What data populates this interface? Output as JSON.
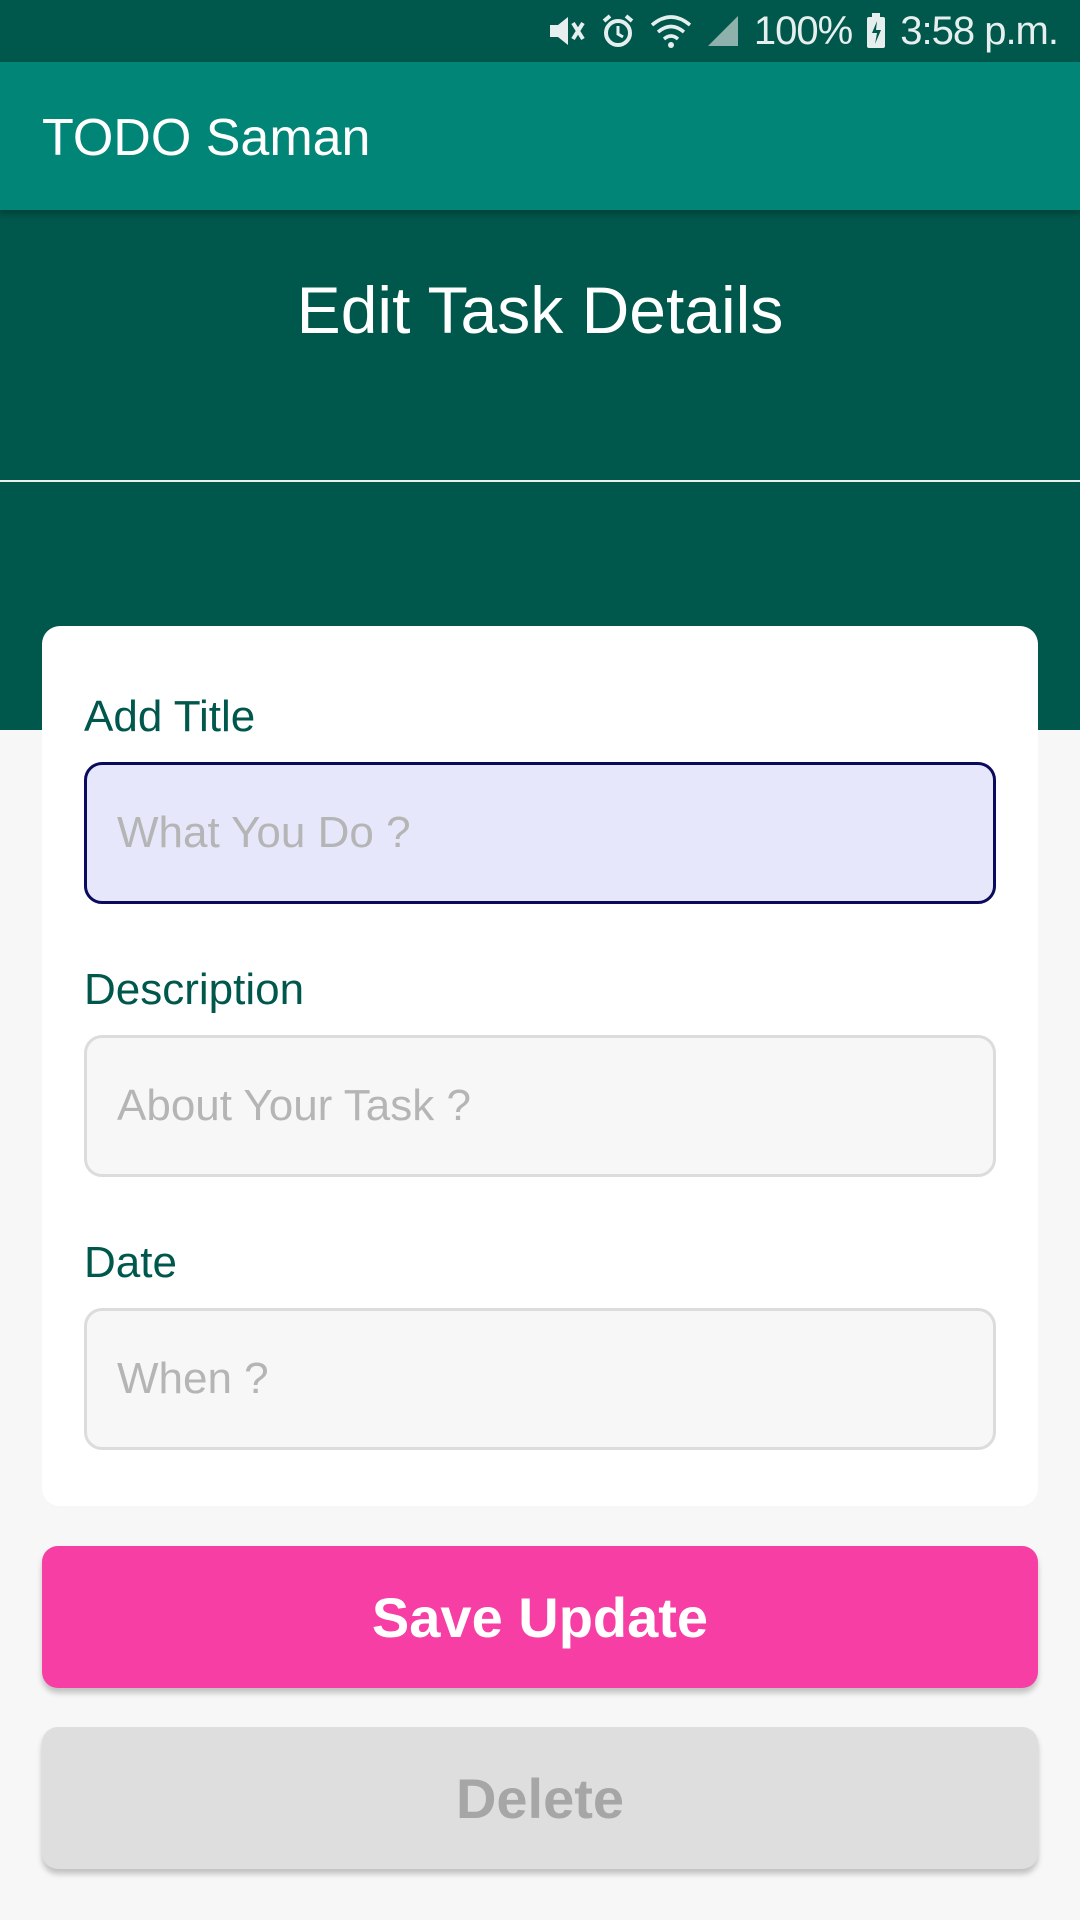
{
  "status_bar": {
    "battery": "100%",
    "time": "3:58 p.m.",
    "icons": [
      "mute-icon",
      "alarm-icon",
      "wifi-icon",
      "signal-icon",
      "battery-charging-icon"
    ]
  },
  "app_bar": {
    "title": "TODO Saman"
  },
  "header": {
    "title": "Edit Task Details"
  },
  "form": {
    "title_field": {
      "label": "Add Title",
      "placeholder": "What You Do ?",
      "value": ""
    },
    "description_field": {
      "label": "Description",
      "placeholder": "About Your Task ?",
      "value": ""
    },
    "date_field": {
      "label": "Date",
      "placeholder": "When ?",
      "value": ""
    }
  },
  "actions": {
    "save_label": "Save Update",
    "delete_label": "Delete"
  },
  "colors": {
    "primary_dark": "#00574b",
    "primary": "#008577",
    "accent": "#f73ea4",
    "disabled": "#dedede"
  }
}
